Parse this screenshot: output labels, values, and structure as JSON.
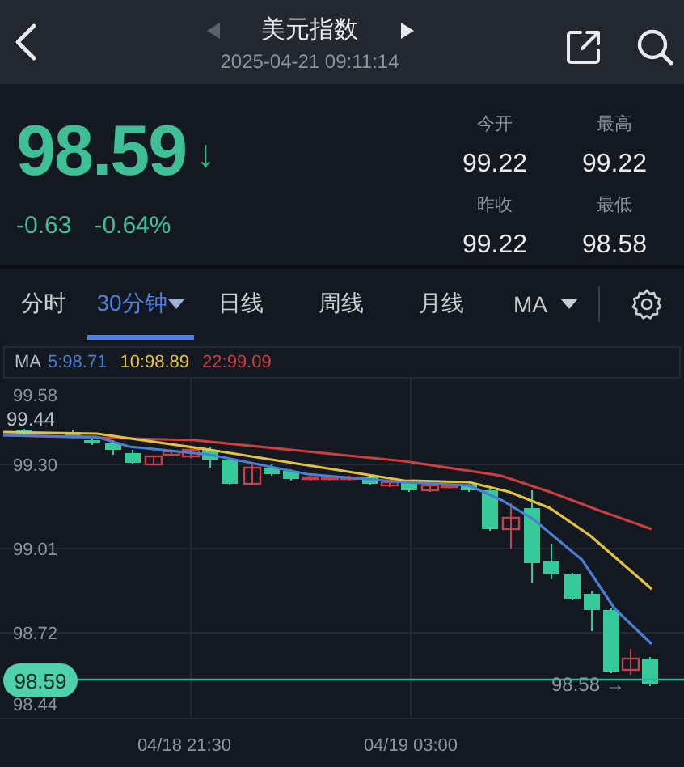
{
  "header": {
    "title": "美元指数",
    "datetime": "2025-04-21 09:11:14"
  },
  "quote": {
    "price": "98.59",
    "arrow": "↓",
    "falling": true,
    "change": "-0.63",
    "change_percent": "-0.64%",
    "stats": [
      {
        "label": "今开",
        "value": "99.22"
      },
      {
        "label": "最高",
        "value": "99.22"
      },
      {
        "label": "昨收",
        "value": "99.22"
      },
      {
        "label": "最低",
        "value": "98.58"
      }
    ]
  },
  "tabs": [
    {
      "label": "分时",
      "selected": false,
      "kind": "plain"
    },
    {
      "label": "30分钟",
      "selected": true,
      "kind": "dropdown"
    },
    {
      "label": "日线",
      "selected": false,
      "kind": "plain"
    },
    {
      "label": "周线",
      "selected": false,
      "kind": "plain"
    },
    {
      "label": "月线",
      "selected": false,
      "kind": "plain"
    },
    {
      "label": "MA",
      "selected": false,
      "kind": "dropdown"
    }
  ],
  "ma_legend": {
    "label": "MA",
    "items": [
      {
        "text": "5:98.71",
        "color": "#4a7fd6"
      },
      {
        "text": "10:98.89",
        "color": "#e3c240"
      },
      {
        "text": "22:99.09",
        "color": "#c9403f"
      }
    ]
  },
  "chart": {
    "y_labels": [
      "99.58",
      "99.30",
      "99.01",
      "98.72",
      "98.44"
    ],
    "x_labels": [
      "04/18 21:30",
      "04/19 03:00"
    ],
    "high_marker": "99.44",
    "current_price": "98.59",
    "low_marker": "98.58 →"
  }
}
